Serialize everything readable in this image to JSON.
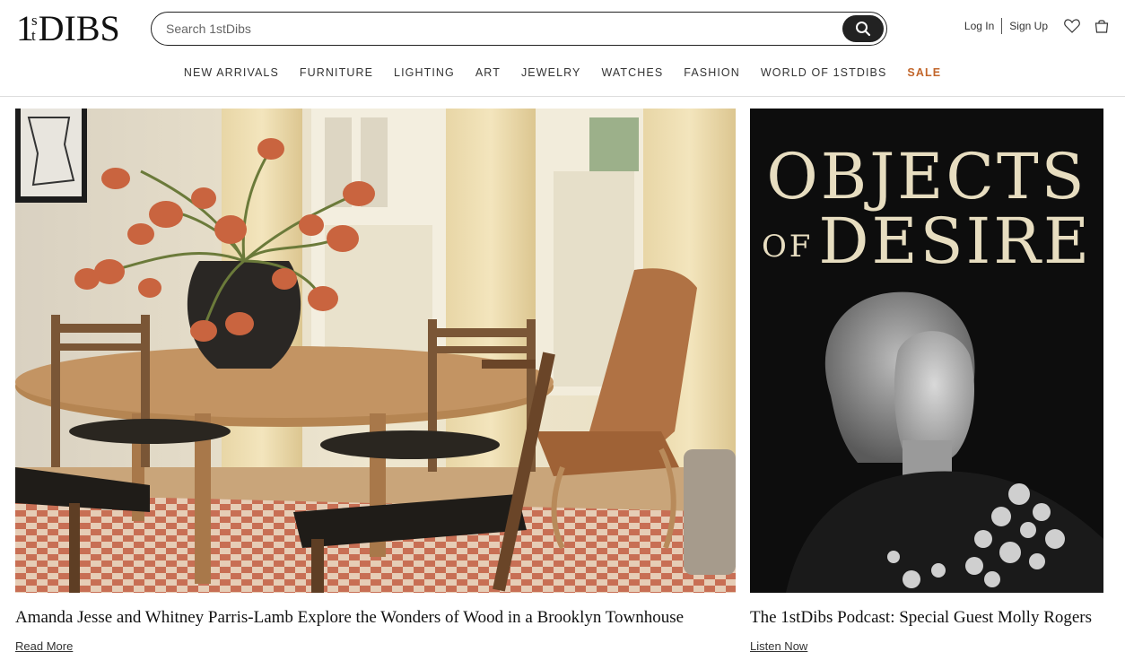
{
  "header": {
    "logo": {
      "one": "1",
      "s": "s",
      "t": "t",
      "dibs": "DIBS"
    },
    "search": {
      "placeholder": "Search 1stDibs"
    },
    "account": {
      "login": "Log In",
      "signup": "Sign Up"
    }
  },
  "nav": {
    "items": [
      "NEW ARRIVALS",
      "FURNITURE",
      "LIGHTING",
      "ART",
      "JEWELRY",
      "WATCHES",
      "FASHION",
      "WORLD OF 1STDIBS",
      "SALE"
    ]
  },
  "cards": [
    {
      "title": "Amanda Jesse and Whitney Parris-Lamb Explore the Wonders of Wood in a Brooklyn Townhouse",
      "link": "Read More"
    },
    {
      "title": "The 1stDibs Podcast: Special Guest Molly Rogers",
      "link": "Listen Now",
      "art": {
        "line1": "OBJECTS",
        "of": "OF",
        "line2": "DESIRE"
      }
    }
  ],
  "colors": {
    "sale": "#c2662b",
    "text": "#222222",
    "podcast_bg": "#0d0d0d",
    "podcast_title": "#e7ddc0"
  }
}
